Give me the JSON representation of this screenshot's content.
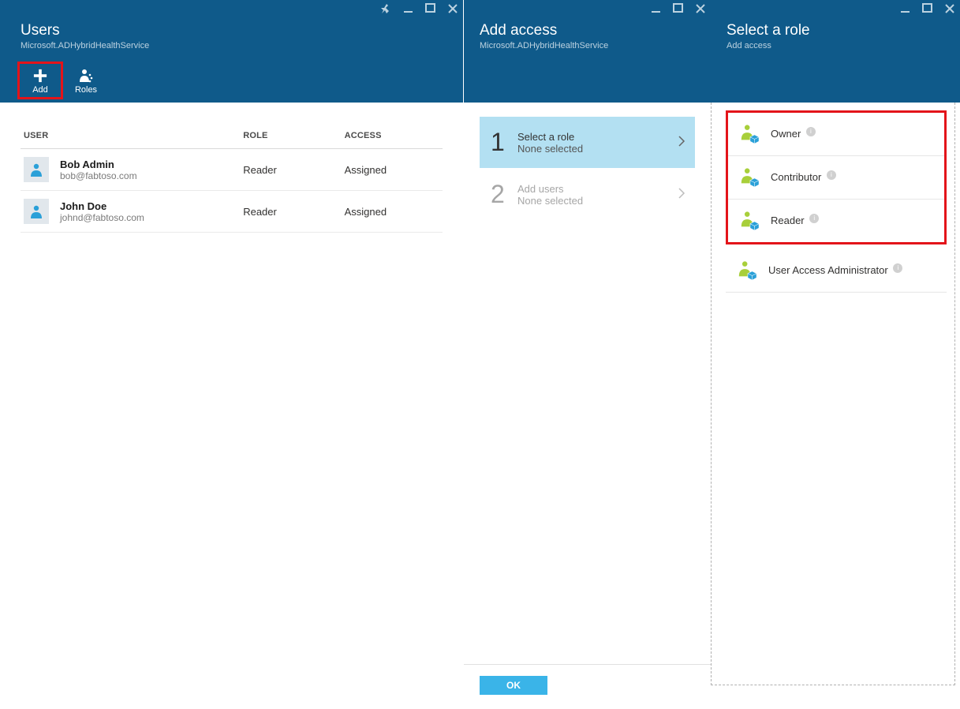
{
  "usersBlade": {
    "title": "Users",
    "subtitle": "Microsoft.ADHybridHealthService",
    "toolbar": {
      "add": "Add",
      "roles": "Roles"
    },
    "columns": {
      "user": "USER",
      "role": "ROLE",
      "access": "ACCESS"
    },
    "rows": [
      {
        "name": "Bob Admin",
        "email": "bob@fabtoso.com",
        "role": "Reader",
        "access": "Assigned"
      },
      {
        "name": "John Doe",
        "email": "johnd@fabtoso.com",
        "role": "Reader",
        "access": "Assigned"
      }
    ]
  },
  "addAccessBlade": {
    "title": "Add access",
    "subtitle": "Microsoft.ADHybridHealthService",
    "step1": {
      "num": "1",
      "label": "Select a role",
      "value": "None selected"
    },
    "step2": {
      "num": "2",
      "label": "Add users",
      "value": "None selected"
    },
    "ok": "OK"
  },
  "selectRoleBlade": {
    "title": "Select a role",
    "subtitle": "Add access",
    "roles": [
      {
        "label": "Owner"
      },
      {
        "label": "Contributor"
      },
      {
        "label": "Reader"
      },
      {
        "label": "User Access Administrator"
      }
    ]
  }
}
